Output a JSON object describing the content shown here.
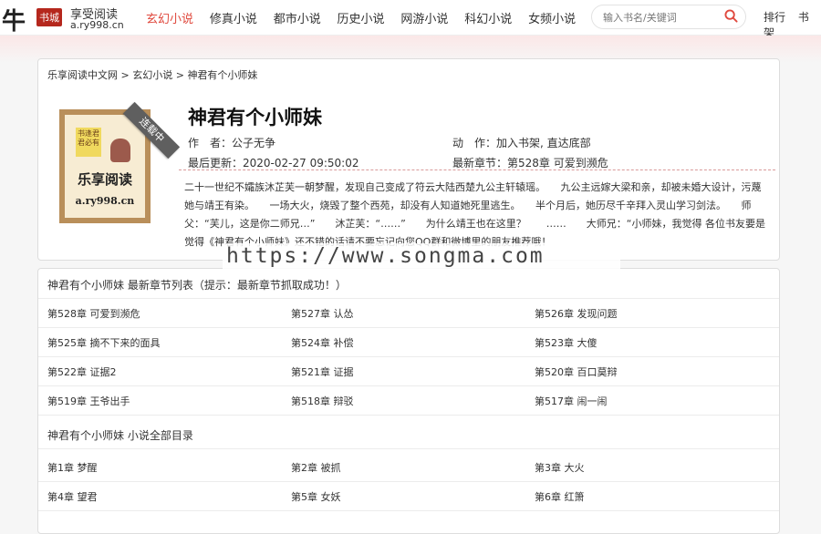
{
  "logo": {
    "big": "牛",
    "badge": "书城",
    "slogan": "享受阅读",
    "domain": "a.ry998.cn"
  },
  "nav": [
    "玄幻小说",
    "修真小说",
    "都市小说",
    "历史小说",
    "网游小说",
    "科幻小说",
    "女频小说"
  ],
  "nav_active": "玄幻小说",
  "search": {
    "placeholder": "输入书名/关键词",
    "icon": "search-icon"
  },
  "top_links": [
    "排行",
    "书架"
  ],
  "breadcrumb": [
    "乐享阅读中文网",
    "玄幻小说",
    "神君有个小师妹"
  ],
  "cover": {
    "stamp": "书逢君 君必有",
    "title": "乐享阅读",
    "domain": "a.ry998.cn",
    "ribbon": "连载中"
  },
  "book": {
    "title": "神君有个小师妹",
    "author_label": "作　者：",
    "author": "公子无争",
    "action_label": "动　作：",
    "add_shelf": "加入书架",
    "go_bottom": "直达底部",
    "updated_label": "最后更新：",
    "updated": "2020-02-27 09:50:02",
    "latest_label": "最新章节：",
    "latest": "第528章 可爱到濒危",
    "description": "二十一世纪不孀族沐芷芙一朝梦醒，发现自己变成了符云大陆西楚九公主轩辕瑶。　　九公主远嫁大梁和亲，却被未婚大设计，污蔑她与靖王有染。　　一场大火，烧毁了整个西苑，却没有人知道她死里逃生。　　半个月后，她历尽千辛拜入灵山学习剑法。　　师父：“芙儿，这是你二师兄…”　　沐芷芙：“……”　　为什么靖王也在这里？　　……　　大师兄：“小师妹，我觉得 各位书友要是觉得《神君有个小师妹》还不错的话请不要忘记向您QQ群和微博里的朋友推荐哦！"
  },
  "latest_header": "神君有个小师妹 最新章节列表（提示：最新章节抓取成功！）",
  "latest_chapters": [
    [
      "第528章 可爱到濒危",
      "第527章 认怂",
      "第526章 发现问题"
    ],
    [
      "第525章 摘不下来的面具",
      "第524章 补偿",
      "第523章 大傻"
    ],
    [
      "第522章 证据2",
      "第521章 证据",
      "第520章 百口莫辩"
    ],
    [
      "第519章 王爷出手",
      "第518章 辩驳",
      "第517章 闹一闹"
    ]
  ],
  "all_header": "神君有个小师妹 小说全部目录",
  "all_chapters": [
    [
      "第1章 梦醒",
      "第2章 被抓",
      "第3章 大火"
    ],
    [
      "第4章 望君",
      "第5章 女妖",
      "第6章 红箫"
    ]
  ],
  "watermark": "https://www.songma.com"
}
